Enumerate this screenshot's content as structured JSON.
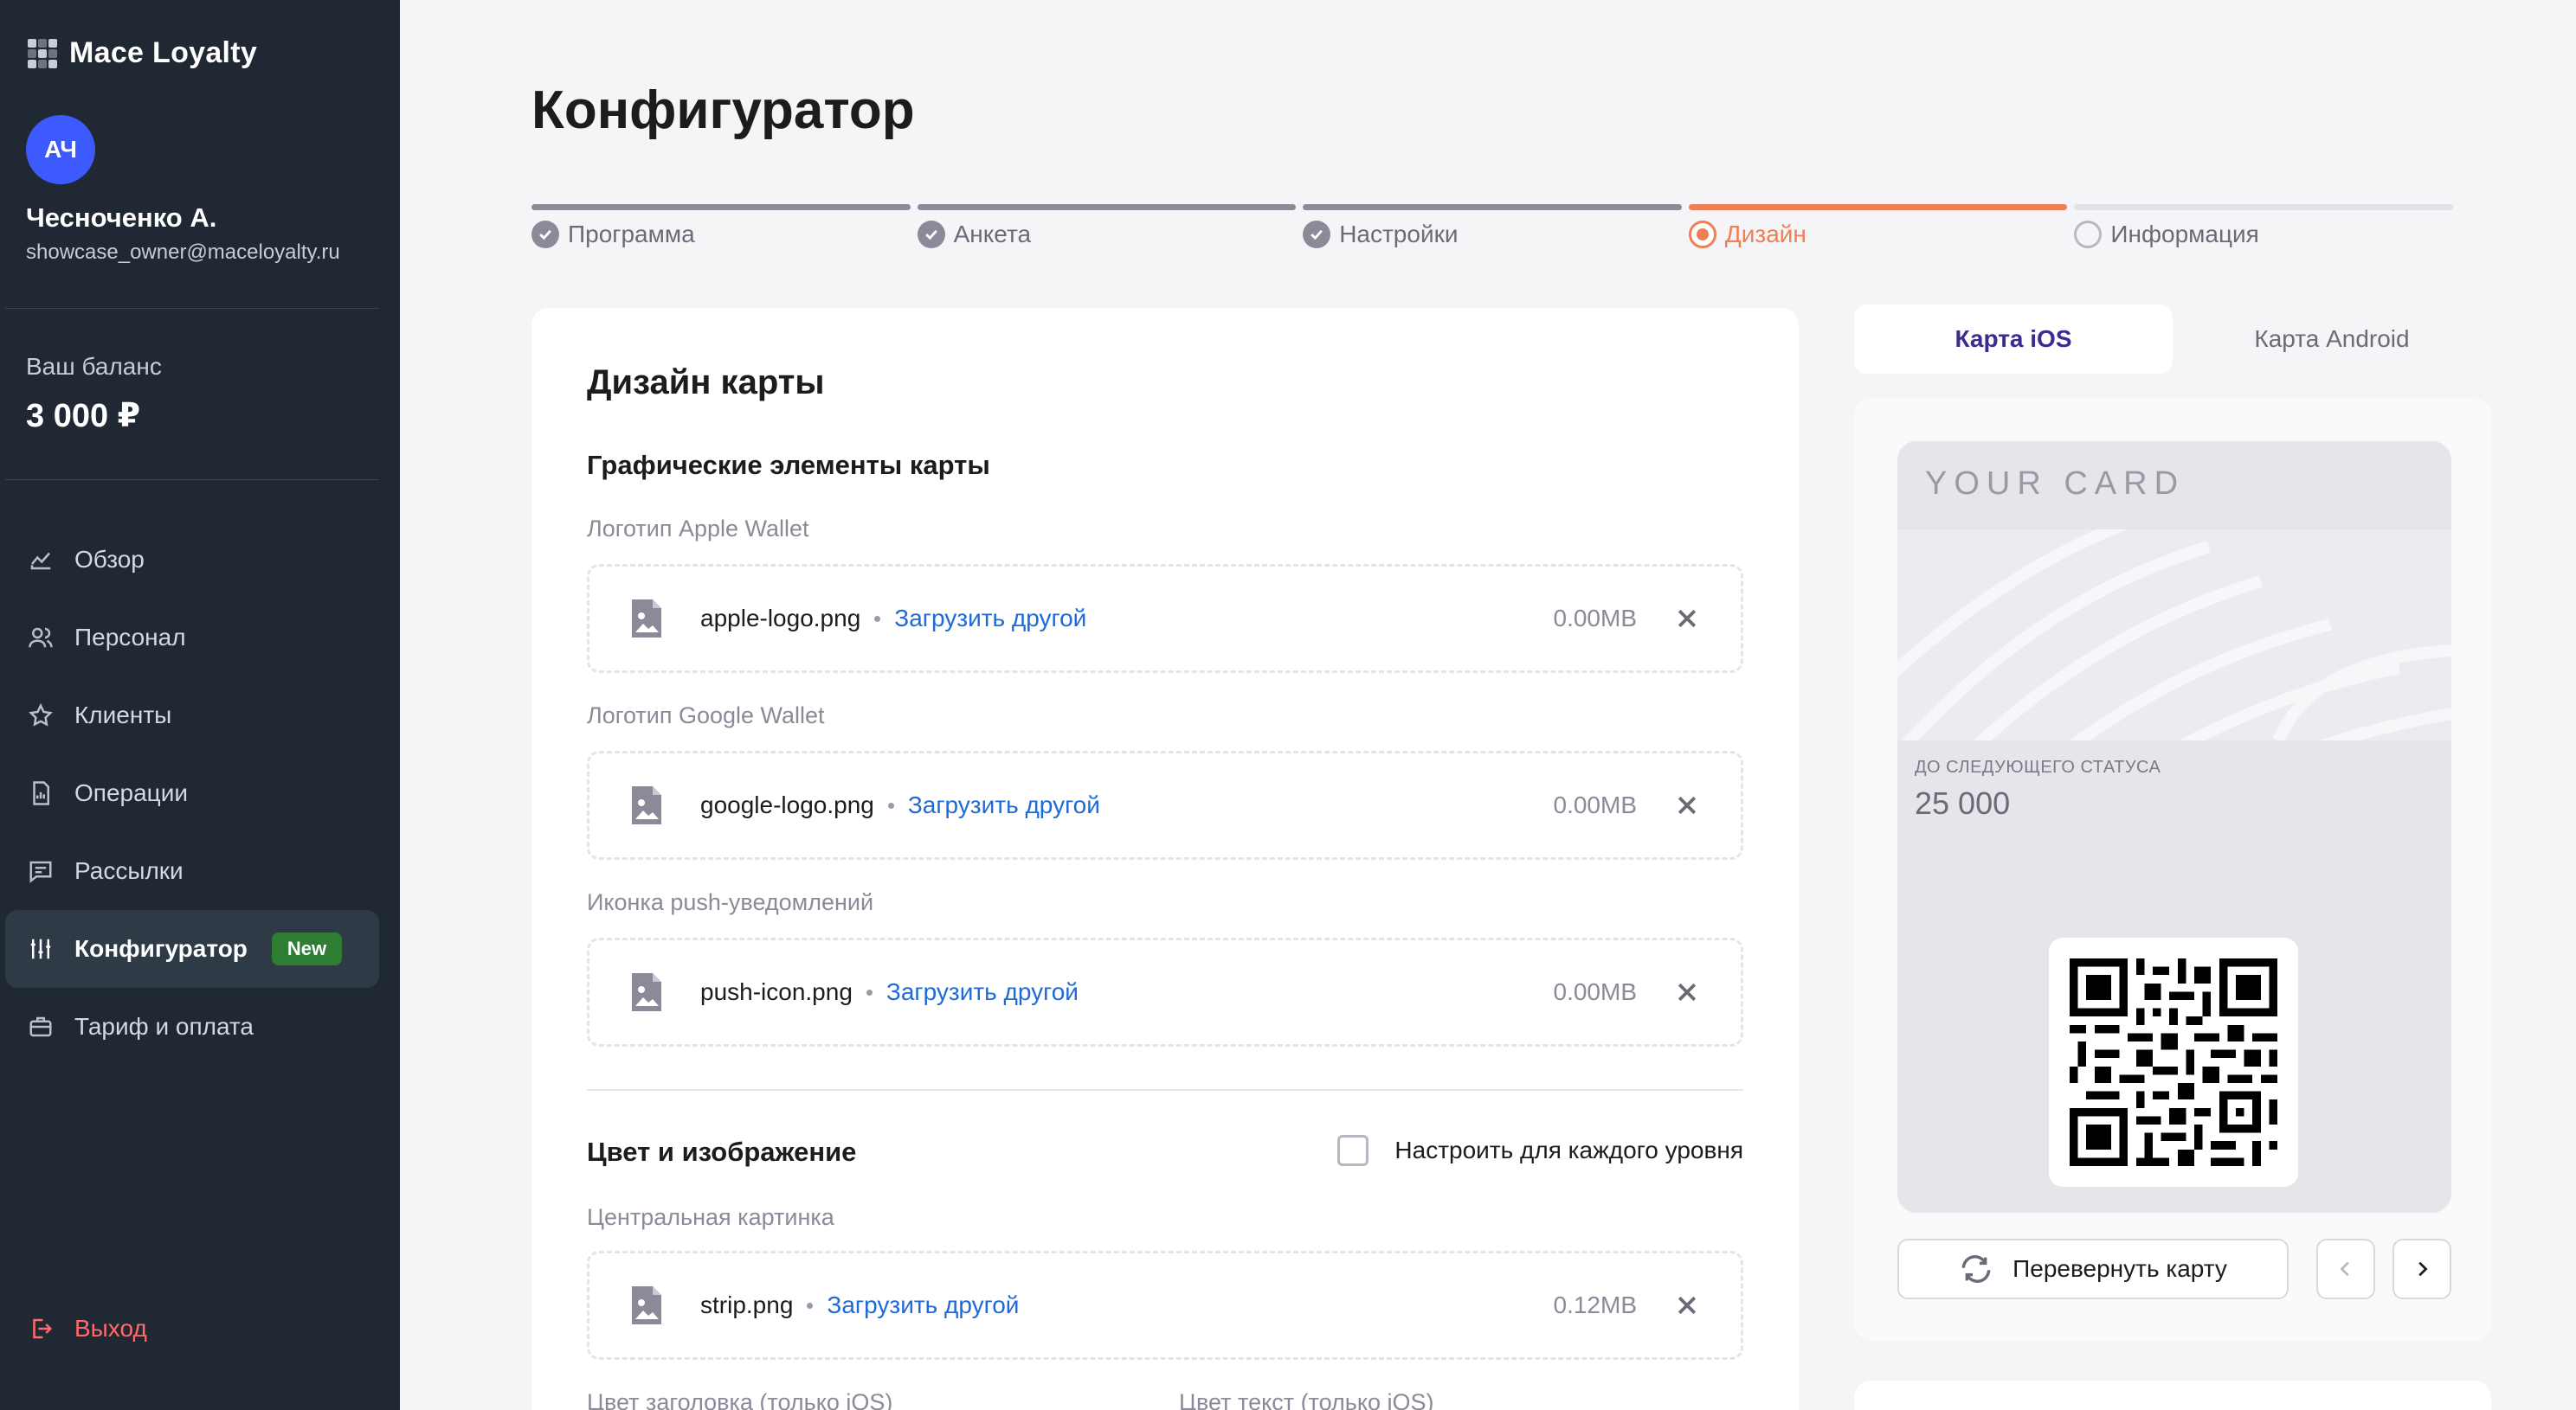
{
  "app": {
    "brand": "Mace Loyalty"
  },
  "user": {
    "initials": "АЧ",
    "name": "Чесноченко А.",
    "email": "showcase_owner@maceloyalty.ru"
  },
  "balance": {
    "label": "Ваш баланс",
    "value": "3 000 ₽"
  },
  "nav": {
    "items": [
      {
        "label": "Обзор",
        "icon": "chart-icon"
      },
      {
        "label": "Персонал",
        "icon": "users-icon"
      },
      {
        "label": "Клиенты",
        "icon": "star-icon"
      },
      {
        "label": "Операции",
        "icon": "document-icon"
      },
      {
        "label": "Рассылки",
        "icon": "message-icon"
      },
      {
        "label": "Конфигуратор",
        "icon": "sliders-icon",
        "active": true,
        "badge": "New"
      },
      {
        "label": "Тариф и оплата",
        "icon": "briefcase-icon"
      }
    ],
    "logout": "Выход"
  },
  "page": {
    "title": "Конфигуратор"
  },
  "stepper": {
    "steps": [
      {
        "label": "Программа",
        "state": "done"
      },
      {
        "label": "Анкета",
        "state": "done"
      },
      {
        "label": "Настройки",
        "state": "done"
      },
      {
        "label": "Дизайн",
        "state": "active"
      },
      {
        "label": "Информация",
        "state": "todo"
      }
    ]
  },
  "form": {
    "title": "Дизайн карты",
    "graphics_section": "Графические элементы карты",
    "replace_label": "Загрузить другой",
    "uploads": [
      {
        "label": "Логотип Apple Wallet",
        "file": "apple-logo.png",
        "size": "0.00MB"
      },
      {
        "label": "Логотип Google Wallet",
        "file": "google-logo.png",
        "size": "0.00MB"
      },
      {
        "label": "Иконка push-уведомлений",
        "file": "push-icon.png",
        "size": "0.00MB"
      }
    ],
    "color_section": "Цвет и изображение",
    "per_level_label": "Настроить для каждого уровня",
    "per_level_checked": false,
    "strip": {
      "label": "Центральная картинка",
      "file": "strip.png",
      "size": "0.12MB"
    },
    "header_color_label": "Цвет заголовка (только iOS)",
    "text_color_label": "Цвет текст (только iOS)"
  },
  "preview": {
    "tabs": [
      {
        "label": "Карта iOS",
        "active": true
      },
      {
        "label": "Карта Android",
        "active": false
      }
    ],
    "card": {
      "title": "YOUR CARD",
      "status_label": "ДО СЛЕДУЮЩЕГО СТАТУСА",
      "status_value": "25 000"
    },
    "flip_label": "Перевернуть карту"
  },
  "colors": {
    "accent": "#ef7f54",
    "sidebar": "#1f2833",
    "link": "#1e6ad8",
    "avatar": "#3d5afe",
    "badge": "#2e7d32",
    "logout": "#ff6b6b"
  }
}
